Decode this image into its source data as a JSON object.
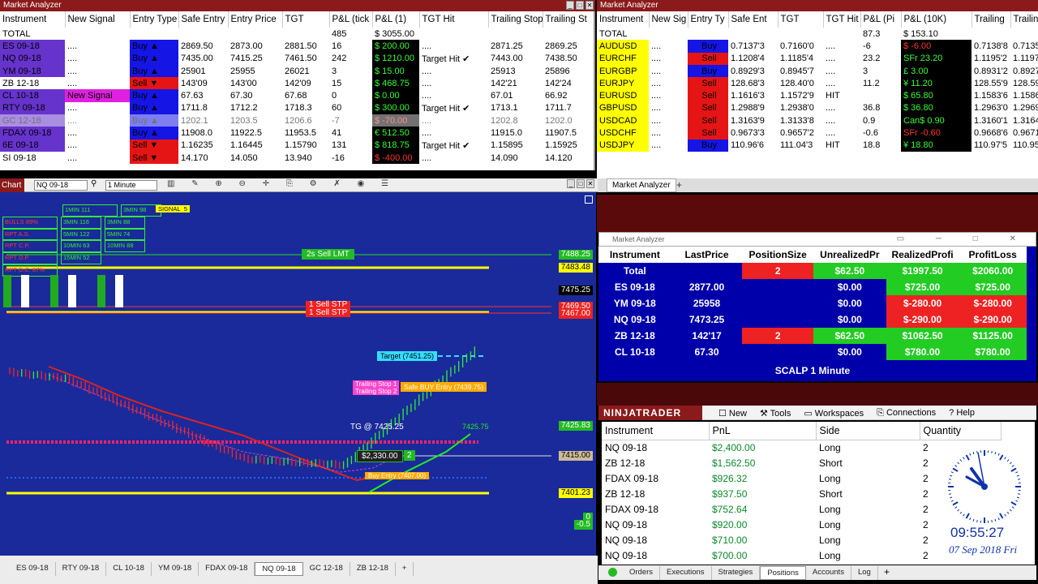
{
  "ma_left": {
    "title": "Market Analyzer",
    "headers": [
      "Instrument",
      "New Signal",
      "Entry Type",
      "Safe Entry",
      "Entry Price",
      "TGT",
      "P&L (tick",
      "P&L (1)",
      "TGT Hit",
      "Trailing Stop",
      "Trailing St"
    ],
    "total": {
      "label": "TOTAL",
      "ticks": "485",
      "pnl": "$ 3055.00"
    },
    "rows": [
      {
        "inst": "ES 09-18",
        "sig": "....",
        "type": "Buy ▲",
        "safe": "2869.50",
        "entry": "2873.00",
        "tgt": "2881.50",
        "ticks": "16",
        "pnl": "$ 200.00",
        "hit": "....",
        "ts1": "2871.25",
        "ts2": "2869.25",
        "side": "buy",
        "instc": "inst"
      },
      {
        "inst": "NQ 09-18",
        "sig": "....",
        "type": "Buy ▲",
        "safe": "7435.00",
        "entry": "7415.25",
        "tgt": "7461.50",
        "ticks": "242",
        "pnl": "$ 1210.00",
        "hit": "Target Hit ✔",
        "ts1": "7443.00",
        "ts2": "7438.50",
        "side": "buy",
        "instc": "inst"
      },
      {
        "inst": "YM 09-18",
        "sig": "....",
        "type": "Buy ▲",
        "safe": "25901",
        "entry": "25955",
        "tgt": "26021",
        "ticks": "3",
        "pnl": "$ 15.00",
        "hit": "....",
        "ts1": "25913",
        "ts2": "25896",
        "side": "buy",
        "instc": "inst"
      },
      {
        "inst": "ZB 12-18",
        "sig": "....",
        "type": "Sell ▼",
        "safe": "143'09",
        "entry": "143'00",
        "tgt": "142'09",
        "ticks": "15",
        "pnl": "$ 468.75",
        "hit": "....",
        "ts1": "142'21",
        "ts2": "142'24",
        "side": "sell",
        "instc": "inst-w"
      },
      {
        "inst": "CL 10-18",
        "sig": "New Signal",
        "type": "Buy ▲",
        "safe": "67.63",
        "entry": "67.30",
        "tgt": "67.68",
        "ticks": "0",
        "pnl": "$ 0.00",
        "hit": "....",
        "ts1": "67.01",
        "ts2": "66.92",
        "side": "buy",
        "instc": "inst"
      },
      {
        "inst": "RTY 09-18",
        "sig": "....",
        "type": "Buy ▲",
        "safe": "1711.8",
        "entry": "1712.2",
        "tgt": "1718.3",
        "ticks": "60",
        "pnl": "$ 300.00",
        "hit": "Target Hit ✔",
        "ts1": "1713.1",
        "ts2": "1711.7",
        "side": "buy",
        "instc": "inst"
      },
      {
        "inst": "GC 12-18",
        "sig": "....",
        "type": "Buy ▲",
        "safe": "1202.1",
        "entry": "1203.5",
        "tgt": "1206.6",
        "ticks": "-7",
        "pnl": "$ -70.00",
        "hit": "....",
        "ts1": "1202.8",
        "ts2": "1202.0",
        "side": "buy",
        "instc": "inst"
      },
      {
        "inst": "FDAX 09-18",
        "sig": "....",
        "type": "Buy ▲",
        "safe": "11908.0",
        "entry": "11922.5",
        "tgt": "11953.5",
        "ticks": "41",
        "pnl": "€ 512.50",
        "hit": "....",
        "ts1": "11915.0",
        "ts2": "11907.5",
        "side": "buy",
        "instc": "inst"
      },
      {
        "inst": "6E 09-18",
        "sig": "....",
        "type": "Sell ▼",
        "safe": "1.16235",
        "entry": "1.16445",
        "tgt": "1.15790",
        "ticks": "131",
        "pnl": "$ 818.75",
        "hit": "Target Hit ✔",
        "ts1": "1.15895",
        "ts2": "1.15925",
        "side": "sell",
        "instc": "inst"
      },
      {
        "inst": "SI 09-18",
        "sig": "....",
        "type": "Sell ▼",
        "safe": "14.170",
        "entry": "14.050",
        "tgt": "13.940",
        "ticks": "-16",
        "pnl": "$ -400.00",
        "hit": "....",
        "ts1": "14.090",
        "ts2": "14.120",
        "side": "sell",
        "instc": "inst-w"
      }
    ]
  },
  "ma_right": {
    "title": "Market Analyzer",
    "headers": [
      "Instrument",
      "New Sig",
      "Entry Ty",
      "Safe Ent",
      "TGT",
      "TGT Hit",
      "P&L (Pi",
      "P&L (10K)",
      "Trailing",
      "Trailing"
    ],
    "total": {
      "label": "TOTAL",
      "pips": "87.3",
      "pnl": "$ 153.10"
    },
    "rows": [
      {
        "inst": "AUDUSD",
        "sig": "....",
        "type": "Buy",
        "safe": "0.7137'3",
        "tgt": "0.7160'0",
        "hit": "....",
        "pips": "-6",
        "pnl": "$ -6.00",
        "t1": "0.7138'8",
        "t2": "0.7135'8",
        "side": "buy"
      },
      {
        "inst": "EURCHF",
        "sig": "....",
        "type": "Sell",
        "safe": "1.1208'4",
        "tgt": "1.1185'4",
        "hit": "....",
        "pips": "23.2",
        "pnl": "SFr 23.20",
        "t1": "1.1195'2",
        "t2": "1.1197'7",
        "side": "sell"
      },
      {
        "inst": "EURGBP",
        "sig": "....",
        "type": "Buy",
        "safe": "0.8929'3",
        "tgt": "0.8945'7",
        "hit": "....",
        "pips": "3",
        "pnl": "£ 3.00",
        "t1": "0.8931'2",
        "t2": "0.8927'5",
        "side": "buy"
      },
      {
        "inst": "EURJPY",
        "sig": "....",
        "type": "Sell",
        "safe": "128.68'3",
        "tgt": "128.40'0",
        "hit": "....",
        "pips": "11.2",
        "pnl": "¥ 11.20",
        "t1": "128.55'9",
        "t2": "128.59'9",
        "side": "sell"
      },
      {
        "inst": "EURUSD",
        "sig": "....",
        "type": "Sell",
        "safe": "1.1616'3",
        "tgt": "1.1572'9",
        "hit": "HIT",
        "pips": "",
        "pnl": "$ 65.80",
        "t1": "1.1583'6",
        "t2": "1.1586'3",
        "side": "sell"
      },
      {
        "inst": "GBPUSD",
        "sig": "....",
        "type": "Sell",
        "safe": "1.2988'9",
        "tgt": "1.2938'0",
        "hit": "....",
        "pips": "36.8",
        "pnl": "$ 36.80",
        "t1": "1.2963'0",
        "t2": "1.2969'3",
        "side": "sell"
      },
      {
        "inst": "USDCAD",
        "sig": "....",
        "type": "Sell",
        "safe": "1.3163'9",
        "tgt": "1.3133'8",
        "hit": "....",
        "pips": "0.9",
        "pnl": "Can$ 0.90",
        "t1": "1.3160'1",
        "t2": "1.3164'4",
        "side": "sell"
      },
      {
        "inst": "USDCHF",
        "sig": "....",
        "type": "Sell",
        "safe": "0.9673'3",
        "tgt": "0.9657'2",
        "hit": "....",
        "pips": "-0.6",
        "pnl": "SFr -0.60",
        "t1": "0.9668'6",
        "t2": "0.9671'1",
        "side": "sell"
      },
      {
        "inst": "USDJPY",
        "sig": "....",
        "type": "Buy",
        "safe": "110.96'6",
        "tgt": "111.04'3",
        "hit": "HIT",
        "pips": "18.8",
        "pnl": "¥ 18.80",
        "t1": "110.97'5",
        "t2": "110.95'8",
        "side": "buy"
      }
    ]
  },
  "ma_tab": "Market Analyzer",
  "chart": {
    "label": "Chart",
    "instrument": "NQ 09-18",
    "interval": "1 Minute",
    "prices": [
      "7488.25",
      "7483.48",
      "7475.25",
      "7469.50",
      "7467.00",
      "7425.83",
      "7415.00",
      "7401.23",
      "0",
      "-0.5"
    ],
    "annotations": {
      "sell_lmt": "2s  Sell LMT",
      "sell_stp1": "1  Sell STP",
      "sell_stp2": "1  Sell STP",
      "target": "Target (7451.25)",
      "trailing1": "Trailing Stop 1",
      "trailing2": "Trailing Stop 2",
      "safe_buy": "Safe BUY Entry (7439.75)",
      "tg": "TG @ 7425.25",
      "pnl_box": "$2,330.00",
      "pnl_qty": "2",
      "buy_entry": "Buy  Entry (7407.00)",
      "val_7425": "7425.75",
      "signal": "SIGNAL",
      "signal_val": "5"
    },
    "panel": [
      [
        "1MIN 111",
        "3MIN 98"
      ],
      [
        "BULLS 89%",
        "3MIN 116",
        "3MIN 88"
      ],
      [
        "RPT A.S.",
        "5MIN 122",
        "5MIN 74"
      ],
      [
        "RPT C.P.",
        "10MIN 63",
        "10MIN 88"
      ],
      [
        "RPT D.P.",
        "15MIN 52"
      ],
      [
        "RPT D.C. 87%"
      ]
    ],
    "tabs": [
      "ES 09-18",
      "RTY 09-18",
      "CL 10-18",
      "YM 09-18",
      "FDAX 09-18",
      "NQ 09-18",
      "GC 12-18",
      "ZB 12-18",
      "+"
    ]
  },
  "positions_window": {
    "title": "Market Analyzer",
    "headers": [
      "Instrument",
      "LastPrice",
      "PositionSize",
      "UnrealizedPr",
      "RealizedProfi",
      "ProfitLoss"
    ],
    "rows": [
      {
        "inst": "Total",
        "last": "",
        "size": "2",
        "unreal": "$62.50",
        "real": "$1997.50",
        "pl": "$2060.00",
        "sizeC": "rcell",
        "unrealC": "gcell",
        "realC": "gcell",
        "plC": "gcell"
      },
      {
        "inst": "ES 09-18",
        "last": "2877.00",
        "size": "",
        "unreal": "$0.00",
        "real": "$725.00",
        "pl": "$725.00",
        "sizeC": "",
        "unrealC": "",
        "realC": "gcell",
        "plC": "gcell"
      },
      {
        "inst": "YM 09-18",
        "last": "25958",
        "size": "",
        "unreal": "$0.00",
        "real": "$-280.00",
        "pl": "$-280.00",
        "sizeC": "",
        "unrealC": "",
        "realC": "rcell",
        "plC": "rcell"
      },
      {
        "inst": "NQ 09-18",
        "last": "7473.25",
        "size": "",
        "unreal": "$0.00",
        "real": "$-290.00",
        "pl": "$-290.00",
        "sizeC": "",
        "unrealC": "",
        "realC": "rcell",
        "plC": "rcell"
      },
      {
        "inst": "ZB 12-18",
        "last": "142'17",
        "size": "2",
        "unreal": "$62.50",
        "real": "$1062.50",
        "pl": "$1125.00",
        "sizeC": "rcell",
        "unrealC": "gcell",
        "realC": "gcell",
        "plC": "gcell"
      },
      {
        "inst": "CL 10-18",
        "last": "67.30",
        "size": "",
        "unreal": "$0.00",
        "real": "$780.00",
        "pl": "$780.00",
        "sizeC": "",
        "unrealC": "",
        "realC": "gcell",
        "plC": "gcell"
      }
    ],
    "footer": "SCALP 1 Minute"
  },
  "ninja": {
    "logo": "NINJATRADER",
    "menu": [
      "New",
      "Tools",
      "Workspaces",
      "Connections",
      "Help"
    ],
    "headers": [
      "Instrument",
      "PnL",
      "Side",
      "Quantity"
    ],
    "rows": [
      {
        "inst": "NQ 09-18",
        "pnl": "$2,400.00",
        "side": "Long",
        "qty": "2"
      },
      {
        "inst": "ZB 12-18",
        "pnl": "$1,562.50",
        "side": "Short",
        "qty": "2"
      },
      {
        "inst": "FDAX 09-18",
        "pnl": "$926.32",
        "side": "Long",
        "qty": "2"
      },
      {
        "inst": "ZB 12-18",
        "pnl": "$937.50",
        "side": "Short",
        "qty": "2"
      },
      {
        "inst": "FDAX 09-18",
        "pnl": "$752.64",
        "side": "Long",
        "qty": "2"
      },
      {
        "inst": "NQ 09-18",
        "pnl": "$920.00",
        "side": "Long",
        "qty": "2"
      },
      {
        "inst": "NQ 09-18",
        "pnl": "$710.00",
        "side": "Long",
        "qty": "2"
      },
      {
        "inst": "NQ 09-18",
        "pnl": "$700.00",
        "side": "Long",
        "qty": "2"
      }
    ],
    "tabs": [
      "Orders",
      "Executions",
      "Strategies",
      "Positions",
      "Accounts",
      "Log"
    ],
    "active_tab": "Positions"
  },
  "clock": {
    "time": "09:55:27",
    "date": "07 Sep 2018 Fri"
  }
}
